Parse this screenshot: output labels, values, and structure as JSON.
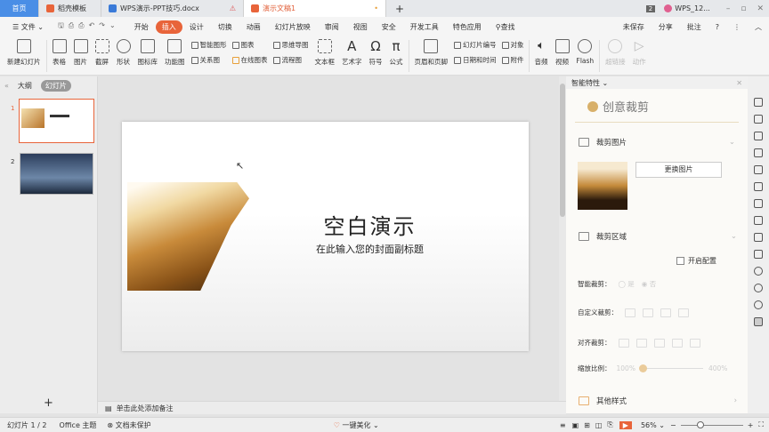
{
  "tabs": [
    {
      "label": "首页"
    },
    {
      "label": "稻壳模板"
    },
    {
      "label": "WPS演示-PPT技巧.docx"
    },
    {
      "label": "演示文稿1"
    }
  ],
  "window": {
    "badge": "2",
    "account": "WPS_12..."
  },
  "menu": {
    "file": "文件",
    "items": [
      "开始",
      "插入",
      "设计",
      "切换",
      "动画",
      "幻灯片放映",
      "审阅",
      "视图",
      "安全",
      "开发工具",
      "特色应用"
    ],
    "search": "查找",
    "unsaved": "未保存",
    "share": "分享",
    "comment": "批注"
  },
  "ribbon": {
    "new_slide": "新建幻灯片",
    "table": "表格",
    "picture": "图片",
    "screenshot": "截屏",
    "shape": "形状",
    "icon_lib": "图标库",
    "func_chart": "功能图",
    "smart_art": "智能图形",
    "relation": "关系图",
    "chart": "图表",
    "online_chart": "在线图表",
    "mindmap": "思维导图",
    "flowchart": "流程图",
    "textbox": "文本框",
    "wordart": "艺术字",
    "symbol": "符号",
    "formula": "公式",
    "header_footer": "页眉和页脚",
    "slide_number": "幻灯片编号",
    "datetime": "日期和时间",
    "object": "对象",
    "attachment": "附件",
    "audio": "音频",
    "video": "视频",
    "flash": "Flash",
    "hyperlink": "超链接",
    "action": "动作"
  },
  "left": {
    "tab_outline": "大纲",
    "tab_slides": "幻灯片",
    "slides": [
      {
        "num": "1"
      },
      {
        "num": "2"
      }
    ],
    "add": "+"
  },
  "slide": {
    "title": "空白演示",
    "subtitle": "在此输入您的封面副标题"
  },
  "notes": "单击此处添加备注",
  "panel": {
    "header": "智能特性",
    "title": "创意裁剪",
    "crop_image": "裁剪图片",
    "replace_image": "更换图片",
    "crop_area": "裁剪区域",
    "enable_config": "开启配置",
    "smart_crop": "智能裁剪：",
    "yes": "是",
    "no": "否",
    "custom_crop": "自定义裁剪：",
    "align_crop": "对齐裁剪：",
    "zoom_ratio": "缩放比例：",
    "zoom_min": "100%",
    "zoom_max": "400%",
    "other_styles": "其他样式"
  },
  "status": {
    "slide_pos": "幻灯片 1 / 2",
    "theme": "Office 主题",
    "protect": "文档未保护",
    "beautify": "一键美化",
    "zoom": "56%"
  }
}
